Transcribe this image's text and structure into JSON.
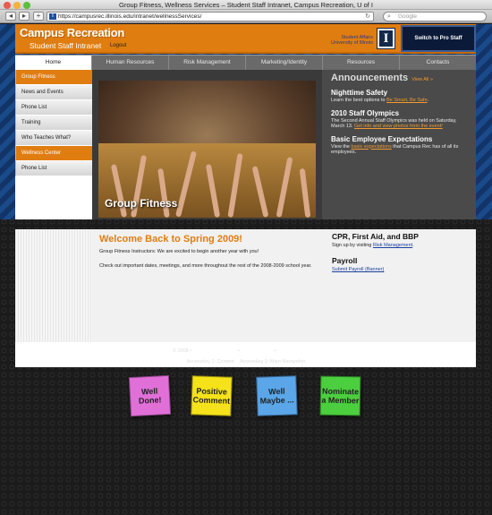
{
  "browser": {
    "window_title": "Group Fitness, Wellness Services – Student Staff Intranet, Campus Recreation, U of I",
    "url": "https://campusrec.illinois.edu/intranet/wellnessServices/",
    "search_placeholder": "Google",
    "url_icon_letter": "I",
    "colors": {
      "close": "#ec5a50",
      "minimize": "#f2b33c",
      "zoom": "#5dbd3e"
    }
  },
  "header": {
    "title": "Campus Recreation",
    "subtitle": "Student Staff Intranet",
    "logout": "Logout",
    "student_affairs": "Student Affairs",
    "university": "University of Illinois",
    "logo_letter": "I",
    "pro_button": "Switch to Pro Staff",
    "colors": {
      "brand_orange": "#e07d10",
      "navy": "#13294b"
    }
  },
  "nav": {
    "tabs": [
      {
        "label": "Home"
      },
      {
        "label": "Human Resources"
      },
      {
        "label": "Risk Management"
      },
      {
        "label": "Marketing/Identity"
      },
      {
        "label": "Resources"
      },
      {
        "label": "Contacts"
      }
    ]
  },
  "sidebar": {
    "items": [
      {
        "label": "Group Fitness"
      },
      {
        "label": "News and Events"
      },
      {
        "label": "Phone List"
      },
      {
        "label": "Training"
      },
      {
        "label": "Who Teaches What?"
      },
      {
        "label": "Wellness Center"
      },
      {
        "label": "Phone List"
      }
    ]
  },
  "hero": {
    "caption": "Group Fitness"
  },
  "announcements": {
    "title": "Announcements",
    "view_all": "View All »",
    "items": [
      {
        "heading": "Nighttime Safety",
        "text": "Learn the best options to ",
        "link": "Be Smart, Be Safe",
        "after": "."
      },
      {
        "heading": "2010 Staff Olympics",
        "text": "The Second Annual Staff Olympics was held on Saturday, March 13. ",
        "link": "Get info and view photos from the event!",
        "after": ""
      },
      {
        "heading": "Basic Employee Expectations",
        "text": "View the ",
        "link": "basic expectations",
        "after": " that Campus Rec has of all its employees."
      }
    ]
  },
  "main": {
    "welcome_title": "Welcome Back to Spring 2009!",
    "paragraph1": "Group Fitness Instructors: We are excited to begin another year with you!",
    "paragraph2": "Check out important dates, meetings, and more throughout the rest of the 2008-2009 school year."
  },
  "right": {
    "cpr_title": "CPR, First Aid, and BBP",
    "cpr_text": "Sign up by visiting ",
    "cpr_link": "Risk Management",
    "cpr_after": ".",
    "payroll_title": "Payroll",
    "payroll_link": "Submit Payroll (Banner)"
  },
  "footer": {
    "copyright": "© 2008 • ",
    "link1": "Campus Recreation",
    "sep1": " • ",
    "link2": "Student Affairs",
    "sep2": " • ",
    "link3": "University of Illinois",
    "access1": "Accesskey 1: Content",
    "access2": "Accesskey 2: Main Navigation"
  },
  "notes": [
    {
      "label": "Well Done!",
      "color": "#e070d8"
    },
    {
      "label": "Positive Comment",
      "color": "#f5e21a"
    },
    {
      "label": "Well Maybe ...",
      "color": "#5aa6e8"
    },
    {
      "label": "Nominate a Member",
      "color": "#4ccf3e"
    }
  ]
}
